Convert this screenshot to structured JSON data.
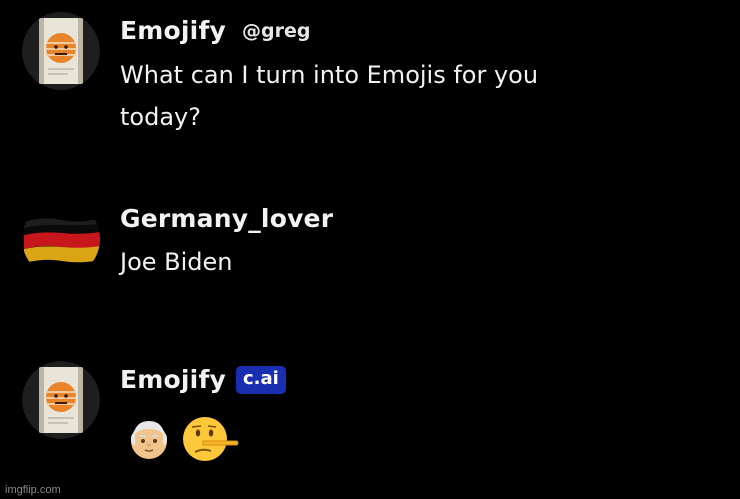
{
  "messages": [
    {
      "name": "Emojify",
      "handle": "@greg",
      "text": "What can I turn into Emojis for you today?"
    },
    {
      "name": "Germany_lover",
      "text": "Joe Biden"
    },
    {
      "name": "Emojify",
      "badge": "c.ai",
      "emojis": [
        "old-man-emoji",
        "lying-face-emoji"
      ]
    }
  ],
  "watermark": "imgflip.com",
  "colors": {
    "background": "#000000",
    "badge": "#1a2fb0",
    "text": "#f2f2f2"
  }
}
